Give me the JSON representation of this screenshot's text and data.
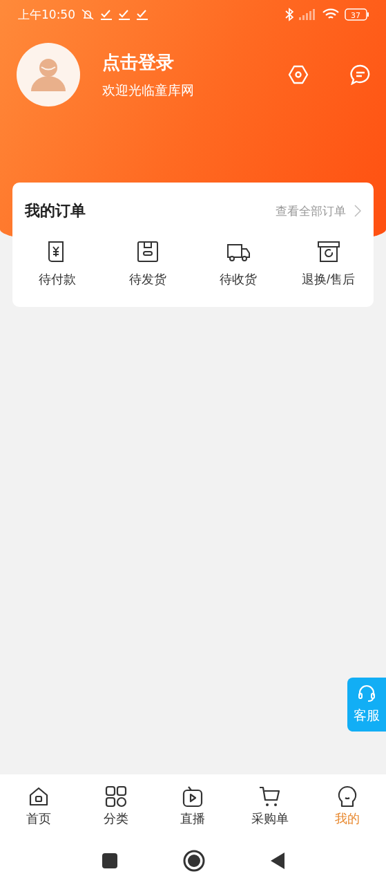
{
  "status_bar": {
    "time": "上午10:50",
    "battery": "37"
  },
  "profile": {
    "title": "点击登录",
    "subtitle": "欢迎光临童库网"
  },
  "orders": {
    "title": "我的订单",
    "link": "查看全部订单",
    "items": [
      {
        "kind": "payment",
        "label": "待付款"
      },
      {
        "kind": "ship",
        "label": "待发货"
      },
      {
        "kind": "receive",
        "label": "待收货"
      },
      {
        "kind": "return",
        "label": "退换/售后"
      }
    ]
  },
  "service_button": {
    "label": "客服"
  },
  "tabs": [
    {
      "kind": "home",
      "label": "首页",
      "selected": false
    },
    {
      "kind": "category",
      "label": "分类",
      "selected": false
    },
    {
      "kind": "live",
      "label": "直播",
      "selected": false
    },
    {
      "kind": "cart",
      "label": "采购单",
      "selected": false
    },
    {
      "kind": "me",
      "label": "我的",
      "selected": true
    }
  ]
}
